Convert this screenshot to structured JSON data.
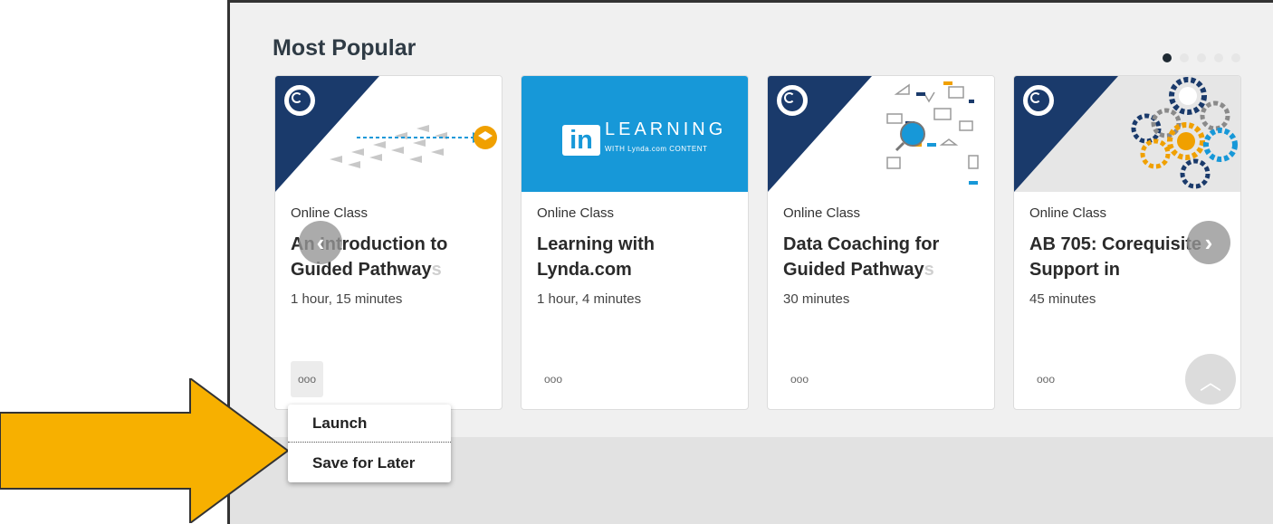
{
  "section": {
    "title": "Most Popular"
  },
  "carousel": {
    "pages": 5,
    "active_page": 1
  },
  "cards": [
    {
      "type": "Online Class",
      "title": "An Introduction to",
      "title_line2": "Guided Pathway",
      "title_fade": "s",
      "duration": "1 hour, 15 minutes",
      "more_label": "ooo"
    },
    {
      "type": "Online Class",
      "title": "Learning with",
      "title_line2": "Lynda.com",
      "title_fade": "",
      "duration": "1 hour, 4 minutes",
      "more_label": "ooo",
      "brand": {
        "in": "in",
        "word": "LEARNING",
        "sub": "WITH Lynda.com CONTENT"
      }
    },
    {
      "type": "Online Class",
      "title": "Data Coaching for",
      "title_line2": "Guided Pathway",
      "title_fade": "s",
      "duration": "30 minutes",
      "more_label": "ooo"
    },
    {
      "type": "Online Class",
      "title": "AB 705: Corequisite",
      "title_line2": "Support in",
      "title_fade": "",
      "duration": "45 minutes",
      "more_label": "ooo"
    }
  ],
  "menu": {
    "items": [
      "Launch",
      "Save for Later"
    ]
  },
  "nav": {
    "prev": "‹",
    "next": "›",
    "top": "︿"
  },
  "colors": {
    "brand_navy": "#1a3a6b",
    "linkedin_blue": "#1798d8",
    "pointer_arrow": "#f7b000"
  }
}
